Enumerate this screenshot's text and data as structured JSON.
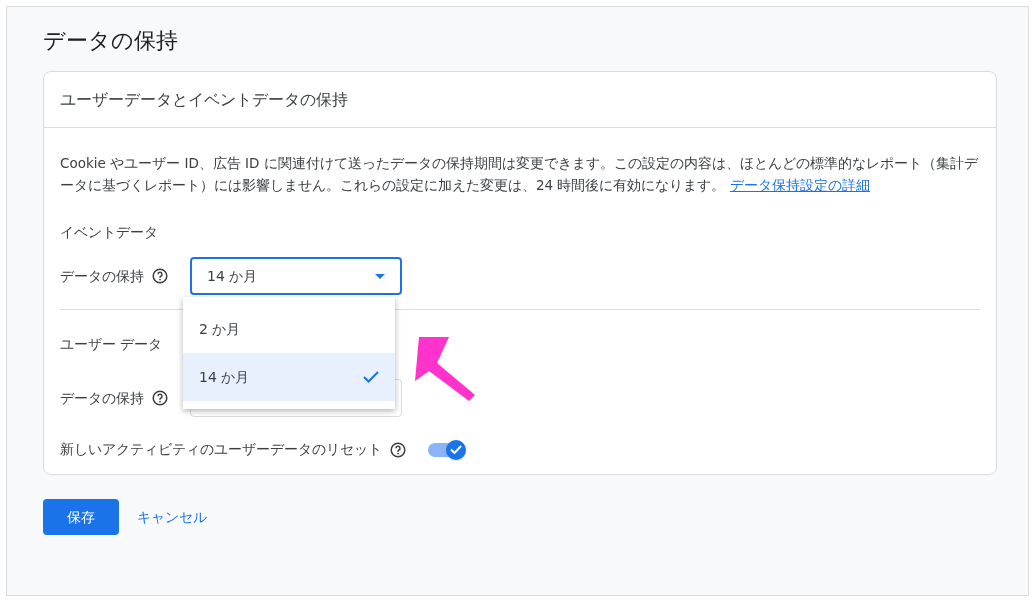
{
  "page_title": "データの保持",
  "card": {
    "title": "ユーザーデータとイベントデータの保持",
    "description": "Cookie やユーザー ID、広告 ID に関連付けて送ったデータの保持期間は変更できます。この設定の内容は、ほとんどの標準的なレポート（集計データに基づくレポート）には影響しません。これらの設定に加えた変更は、24 時間後に有効になります。",
    "link": "データ保持設定の詳細",
    "event_section": {
      "heading": "イベントデータ",
      "label": "データの保持",
      "value": "14 か月",
      "expanded": true,
      "options": [
        {
          "label": "2 か月",
          "selected": false
        },
        {
          "label": "14 か月",
          "selected": true
        }
      ]
    },
    "user_section": {
      "heading": "ユーザー データ",
      "label": "データの保持"
    },
    "reset": {
      "label": "新しいアクティビティのユーザーデータのリセット",
      "on": true
    }
  },
  "buttons": {
    "save": "保存",
    "cancel": "キャンセル"
  }
}
